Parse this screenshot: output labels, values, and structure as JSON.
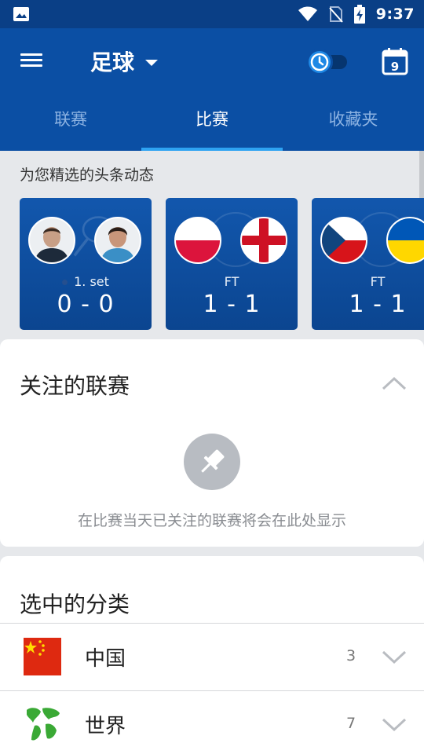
{
  "status_bar": {
    "time": "9:37",
    "icons": [
      "image-icon",
      "wifi-icon",
      "no-sim-icon",
      "battery-charging-icon"
    ]
  },
  "app_bar": {
    "sport": "足球",
    "tabs": [
      {
        "label": "联赛",
        "active": false
      },
      {
        "label": "比赛",
        "active": true
      },
      {
        "label": "收藏夹",
        "active": false
      }
    ],
    "calendar_day": "9"
  },
  "headlines": {
    "title": "为您精选的头条动态",
    "cards": [
      {
        "status": "1. set",
        "score": "0 - 0",
        "home": "tennis-player-1",
        "away": "tennis-player-2"
      },
      {
        "status": "FT",
        "score": "1 - 1",
        "home": "poland-flag",
        "away": "england-flag"
      },
      {
        "status": "FT",
        "score": "1 - 1",
        "home": "czech-flag",
        "away": "ukraine-flag"
      }
    ]
  },
  "followed_leagues": {
    "title": "关注的联赛",
    "empty_message": "在比赛当天已关注的联赛将会在此处显示"
  },
  "selected_categories": {
    "title": "选中的分类",
    "items": [
      {
        "name": "中国",
        "count": "3",
        "icon": "china-flag"
      },
      {
        "name": "世界",
        "count": "7",
        "icon": "world-map-icon"
      }
    ]
  },
  "colors": {
    "status_bar": "#0a3f86",
    "app_bar": "#0b4fa4",
    "tab_indicator": "#2ea3f2",
    "page_background": "#e6e8eb"
  }
}
